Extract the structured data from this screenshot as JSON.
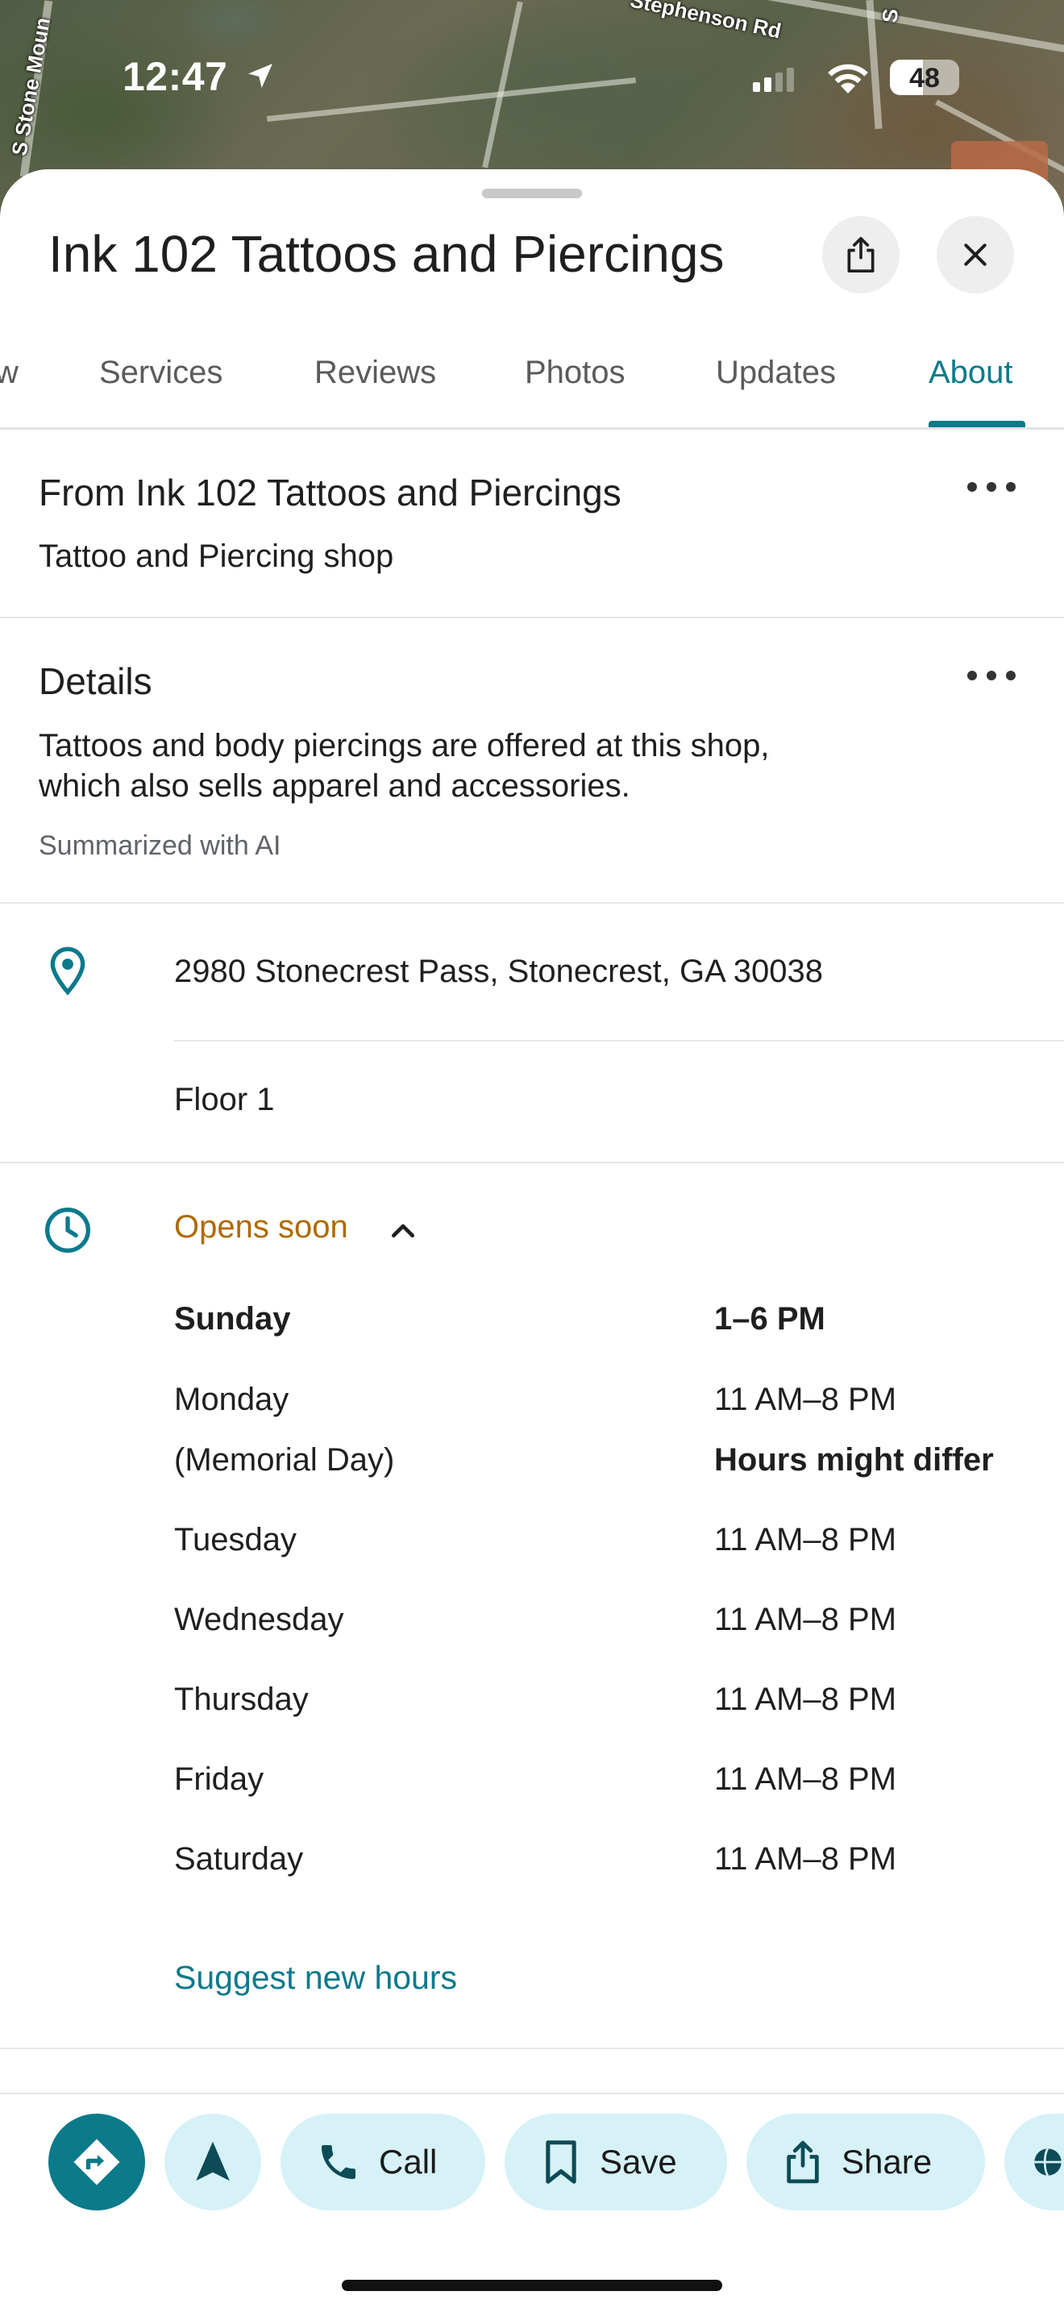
{
  "status_bar": {
    "time": "12:47",
    "battery_level": "48",
    "battery_fraction": 0.48,
    "signal_bars_active": 2
  },
  "map": {
    "labels": [
      "Stephenson Rd",
      "S Stone Moun",
      "S"
    ]
  },
  "place": {
    "name": "Ink 102 Tattoos and Piercings"
  },
  "header": {
    "share_icon": "share-icon",
    "close_icon": "close-icon"
  },
  "tabs": [
    {
      "label": "w",
      "active": false
    },
    {
      "label": "Services",
      "active": false
    },
    {
      "label": "Reviews",
      "active": false
    },
    {
      "label": "Photos",
      "active": false
    },
    {
      "label": "Updates",
      "active": false
    },
    {
      "label": "About",
      "active": true
    }
  ],
  "from_section": {
    "heading": "From Ink 102 Tattoos and Piercings",
    "category": "Tattoo and Piercing shop"
  },
  "details": {
    "heading": "Details",
    "line1": "Tattoos and body piercings are offered at this shop,",
    "line2": "which also sells apparel and accessories.",
    "note": "Summarized with AI"
  },
  "address": {
    "street": "2980 Stonecrest Pass, Stonecrest, GA 30038",
    "floor": "Floor 1"
  },
  "hours": {
    "status": "Opens soon",
    "days": [
      {
        "day": "Sunday",
        "hours": "1–6 PM"
      },
      {
        "day": "Monday",
        "note": "(Memorial Day)",
        "hours": "11 AM–8 PM",
        "hours_note": "Hours might differ"
      },
      {
        "day": "Tuesday",
        "hours": "11 AM–8 PM"
      },
      {
        "day": "Wednesday",
        "hours": "11 AM–8 PM"
      },
      {
        "day": "Thursday",
        "hours": "11 AM–8 PM"
      },
      {
        "day": "Friday",
        "hours": "11 AM–8 PM"
      },
      {
        "day": "Saturday",
        "hours": "11 AM–8 PM"
      }
    ],
    "suggest_link": "Suggest new hours"
  },
  "actions": {
    "call": "Call",
    "save": "Save",
    "share": "Share"
  },
  "colors": {
    "accent": "#0b7a8b",
    "pill_bg": "#d6f2f7",
    "opens_soon": "#b06a00"
  }
}
